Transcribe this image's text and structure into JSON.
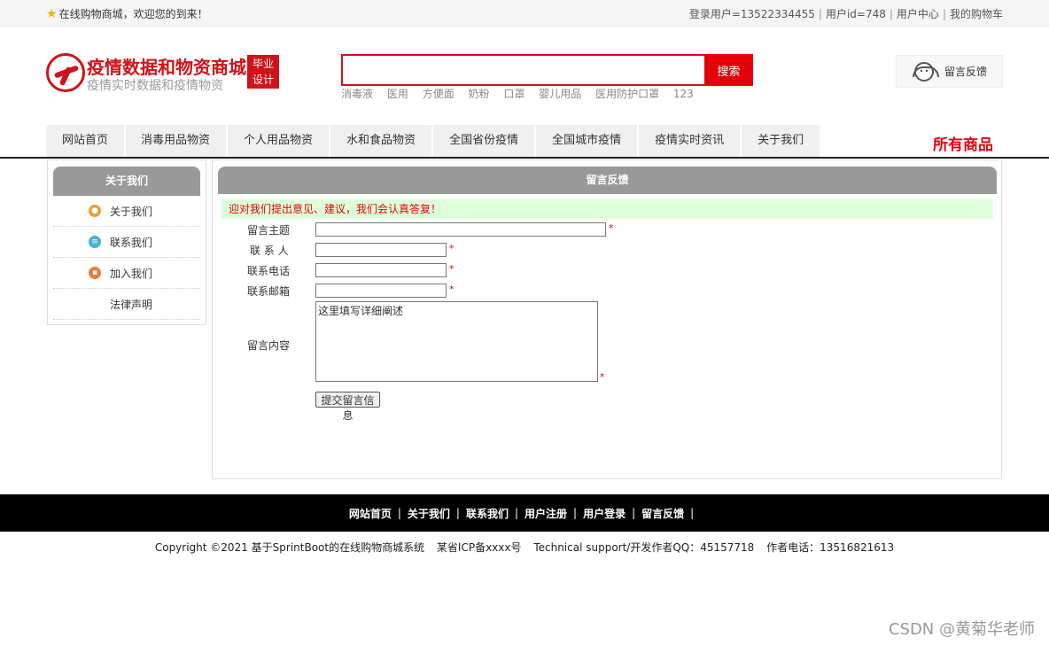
{
  "topbar": {
    "welcome": "在线购物商城，欢迎您的到来！",
    "user_label": "登录用户=13522334455",
    "user_id": "用户id=748",
    "user_center": "用户中心",
    "cart": "我的购物车"
  },
  "header": {
    "brand_title": "疫情数据和物资商城",
    "brand_subtitle": "疫情实时数据和疫情物资",
    "badge_line1": "毕业",
    "badge_line2": "设计",
    "search_value": "",
    "search_button": "搜索",
    "hotwords": [
      "消毒液",
      "医用",
      "方便面",
      "奶粉",
      "口罩",
      "婴儿用品",
      "医用防护口罩",
      "123"
    ],
    "feedback_label": "留言反馈"
  },
  "nav": {
    "items": [
      "网站首页",
      "消毒用品物资",
      "个人用品物资",
      "水和食品物资",
      "全国省份疫情",
      "全国城市疫情",
      "疫情实时资讯",
      "关于我们"
    ],
    "all_goods": "所有商品"
  },
  "sidebar": {
    "title": "关于我们",
    "items": [
      "关于我们",
      "联系我们",
      "加入我们",
      "法律声明"
    ]
  },
  "main": {
    "title": "留言反馈",
    "notice": "迎对我们提出意见、建议，我们会认真答复！",
    "labels": {
      "subject": "留言主题",
      "contact": "联 系 人",
      "phone": "联系电话",
      "email": "联系邮箱",
      "content": "留言内容"
    },
    "content_value": "这里填写详细阐述",
    "required_mark": "*",
    "submit_label": "提交留言信息"
  },
  "footer": {
    "links": [
      "网站首页",
      "关于我们",
      "联系我们",
      "用户注册",
      "用户登录",
      "留言反馈"
    ],
    "link_separator": "|",
    "copyright": "Copyright ©2021 基于SprintBoot的在线购物商城系统",
    "icp": "某省ICP备xxxx号",
    "support": "Technical support/开发作者QQ：45157718",
    "phone": "作者电话：13516821613"
  },
  "watermark": "CSDN @黄菊华老师",
  "colors": {
    "brand_red": "#d2121a",
    "search_red": "#e4020b",
    "panel_gray": "#999999",
    "notice_bg": "#ddffd9"
  }
}
